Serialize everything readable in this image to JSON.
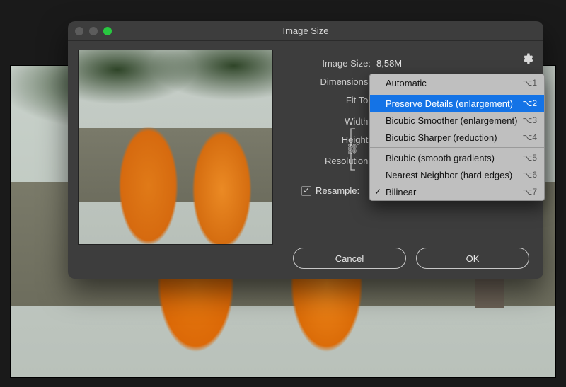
{
  "dialog": {
    "title": "Image Size",
    "imageSize": {
      "label": "Image Size:",
      "value": "8,58M"
    },
    "dimensions": {
      "label": "Dimensions:"
    },
    "fitTo": {
      "label": "Fit To:"
    },
    "width": {
      "label": "Width:"
    },
    "height": {
      "label": "Height:"
    },
    "resolution": {
      "label": "Resolution:"
    },
    "resample": {
      "label": "Resample:"
    },
    "buttons": {
      "cancel": "Cancel",
      "ok": "OK"
    }
  },
  "dropdown": {
    "items": [
      {
        "label": "Automatic",
        "shortcut": "⌥1"
      },
      {
        "label": "Preserve Details (enlargement)",
        "shortcut": "⌥2"
      },
      {
        "label": "Bicubic Smoother (enlargement)",
        "shortcut": "⌥3"
      },
      {
        "label": "Bicubic Sharper (reduction)",
        "shortcut": "⌥4"
      },
      {
        "label": "Bicubic (smooth gradients)",
        "shortcut": "⌥5"
      },
      {
        "label": "Nearest Neighbor (hard edges)",
        "shortcut": "⌥6"
      },
      {
        "label": "Bilinear",
        "shortcut": "⌥7"
      }
    ],
    "selectedIndex": 1,
    "checkedIndex": 6
  }
}
